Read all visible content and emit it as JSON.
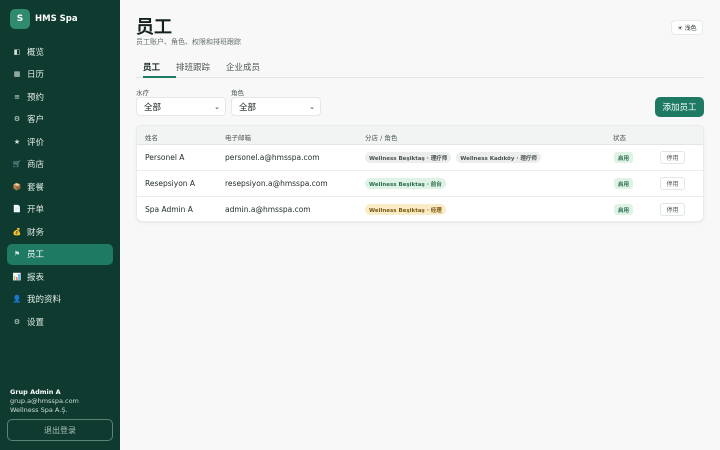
{
  "app": {
    "logo_letter": "S",
    "name": "HMS Spa"
  },
  "sidebar": {
    "items": [
      {
        "label": "概览",
        "icon": "grid-icon",
        "glyph": "◧"
      },
      {
        "label": "日历",
        "icon": "calendar-icon",
        "glyph": "▦"
      },
      {
        "label": "预约",
        "icon": "list-icon",
        "glyph": "≡"
      },
      {
        "label": "客户",
        "icon": "customer-icon",
        "glyph": "⚙"
      },
      {
        "label": "评价",
        "icon": "star-icon",
        "glyph": "★"
      },
      {
        "label": "商店",
        "icon": "cart-icon",
        "glyph": "🛒"
      },
      {
        "label": "套餐",
        "icon": "package-icon",
        "glyph": "📦"
      },
      {
        "label": "开单",
        "icon": "receipt-icon",
        "glyph": "📄"
      },
      {
        "label": "财务",
        "icon": "money-bag-icon",
        "glyph": "💰"
      },
      {
        "label": "员工",
        "icon": "flag-icon",
        "glyph": "⚑"
      },
      {
        "label": "报表",
        "icon": "chart-icon",
        "glyph": "📊"
      },
      {
        "label": "我的资料",
        "icon": "user-icon",
        "glyph": "👤"
      },
      {
        "label": "设置",
        "icon": "gear-icon",
        "glyph": "⚙"
      }
    ],
    "active_index": 9,
    "user": {
      "name": "Grup Admin A",
      "email": "grup.a@hmsspa.com",
      "org": "Wellness Spa A.Ş."
    },
    "logout_label": "退出登录"
  },
  "header": {
    "title": "员工",
    "subtitle": "员工账户、角色、权限和排班跟踪",
    "theme_toggle": "☀ 浅色"
  },
  "tabs": [
    {
      "label": "员工",
      "active": true
    },
    {
      "label": "排班跟踪",
      "active": false
    },
    {
      "label": "企业成员",
      "active": false
    }
  ],
  "filters": {
    "spa": {
      "label": "水疗",
      "value": "全部"
    },
    "role": {
      "label": "角色",
      "value": "全部"
    }
  },
  "add_button": "添加员工",
  "table": {
    "columns": [
      "姓名",
      "电子邮箱",
      "分店 / 角色",
      "状态"
    ],
    "rows": [
      {
        "name": "Personel A",
        "email": "personel.a@hmsspa.com",
        "branches": [
          {
            "text": "Wellness Beşiktaş · 理疗师",
            "tone": "gray"
          },
          {
            "text": "Wellness Kadıköy · 理疗师",
            "tone": "gray"
          }
        ],
        "status": "启用",
        "action": "停用"
      },
      {
        "name": "Resepsiyon A",
        "email": "resepsiyon.a@hmsspa.com",
        "branches": [
          {
            "text": "Wellness Beşiktaş · 前台",
            "tone": "green"
          }
        ],
        "status": "启用",
        "action": "停用"
      },
      {
        "name": "Spa Admin A",
        "email": "admin.a@hmsspa.com",
        "branches": [
          {
            "text": "Wellness Beşiktaş · 经理",
            "tone": "amber"
          }
        ],
        "status": "启用",
        "action": "停用"
      }
    ]
  },
  "colors": {
    "sidebar_bg": "#0e3a30",
    "accent": "#1f7a63"
  }
}
